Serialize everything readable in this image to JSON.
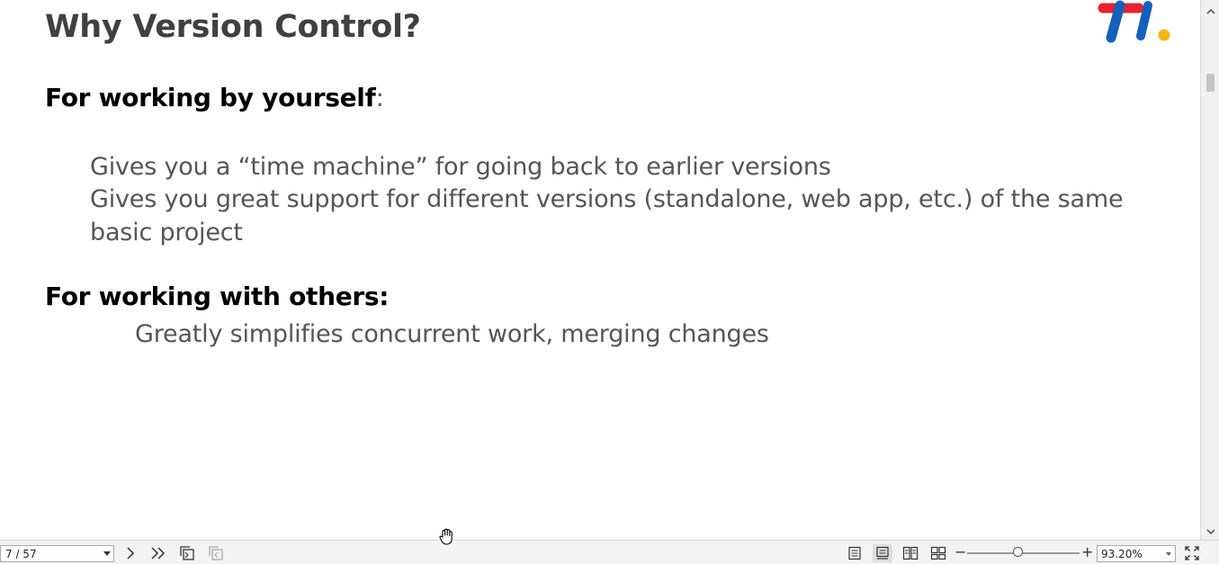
{
  "slide": {
    "title": "Why Version Control?",
    "section1": {
      "heading": "For working by yourself",
      "heading_suffix": ":",
      "lines": [
        "Gives you a “time machine” for going back to earlier versions",
        "Gives you great support for different versions (standalone, web app, etc.) of the same",
        "basic project"
      ]
    },
    "section2": {
      "heading": "For working with others:",
      "lines": [
        "Greatly simplifies concurrent work, merging changes"
      ]
    },
    "logo": {
      "icon": "ti-logo",
      "colors": [
        "#e8212e",
        "#1560bd",
        "#f7b512"
      ]
    }
  },
  "scrollbar": {
    "up_icon": "chevron-up-icon",
    "down_icon": "chevron-down-icon"
  },
  "toolbar": {
    "page_indicator": "7 / 57",
    "icons": [
      "next-page-icon",
      "last-page-icon",
      "copy-icon",
      "paste-icon",
      "single-page-view-icon",
      "continuous-view-icon",
      "two-page-view-icon",
      "book-view-icon",
      "fullscreen-icon"
    ],
    "zoom_minus": "−",
    "zoom_plus": "+",
    "zoom_value": "93.20%",
    "zoom_level_percent": 93.2
  },
  "cursor": {
    "icon": "hand-cursor-icon"
  }
}
